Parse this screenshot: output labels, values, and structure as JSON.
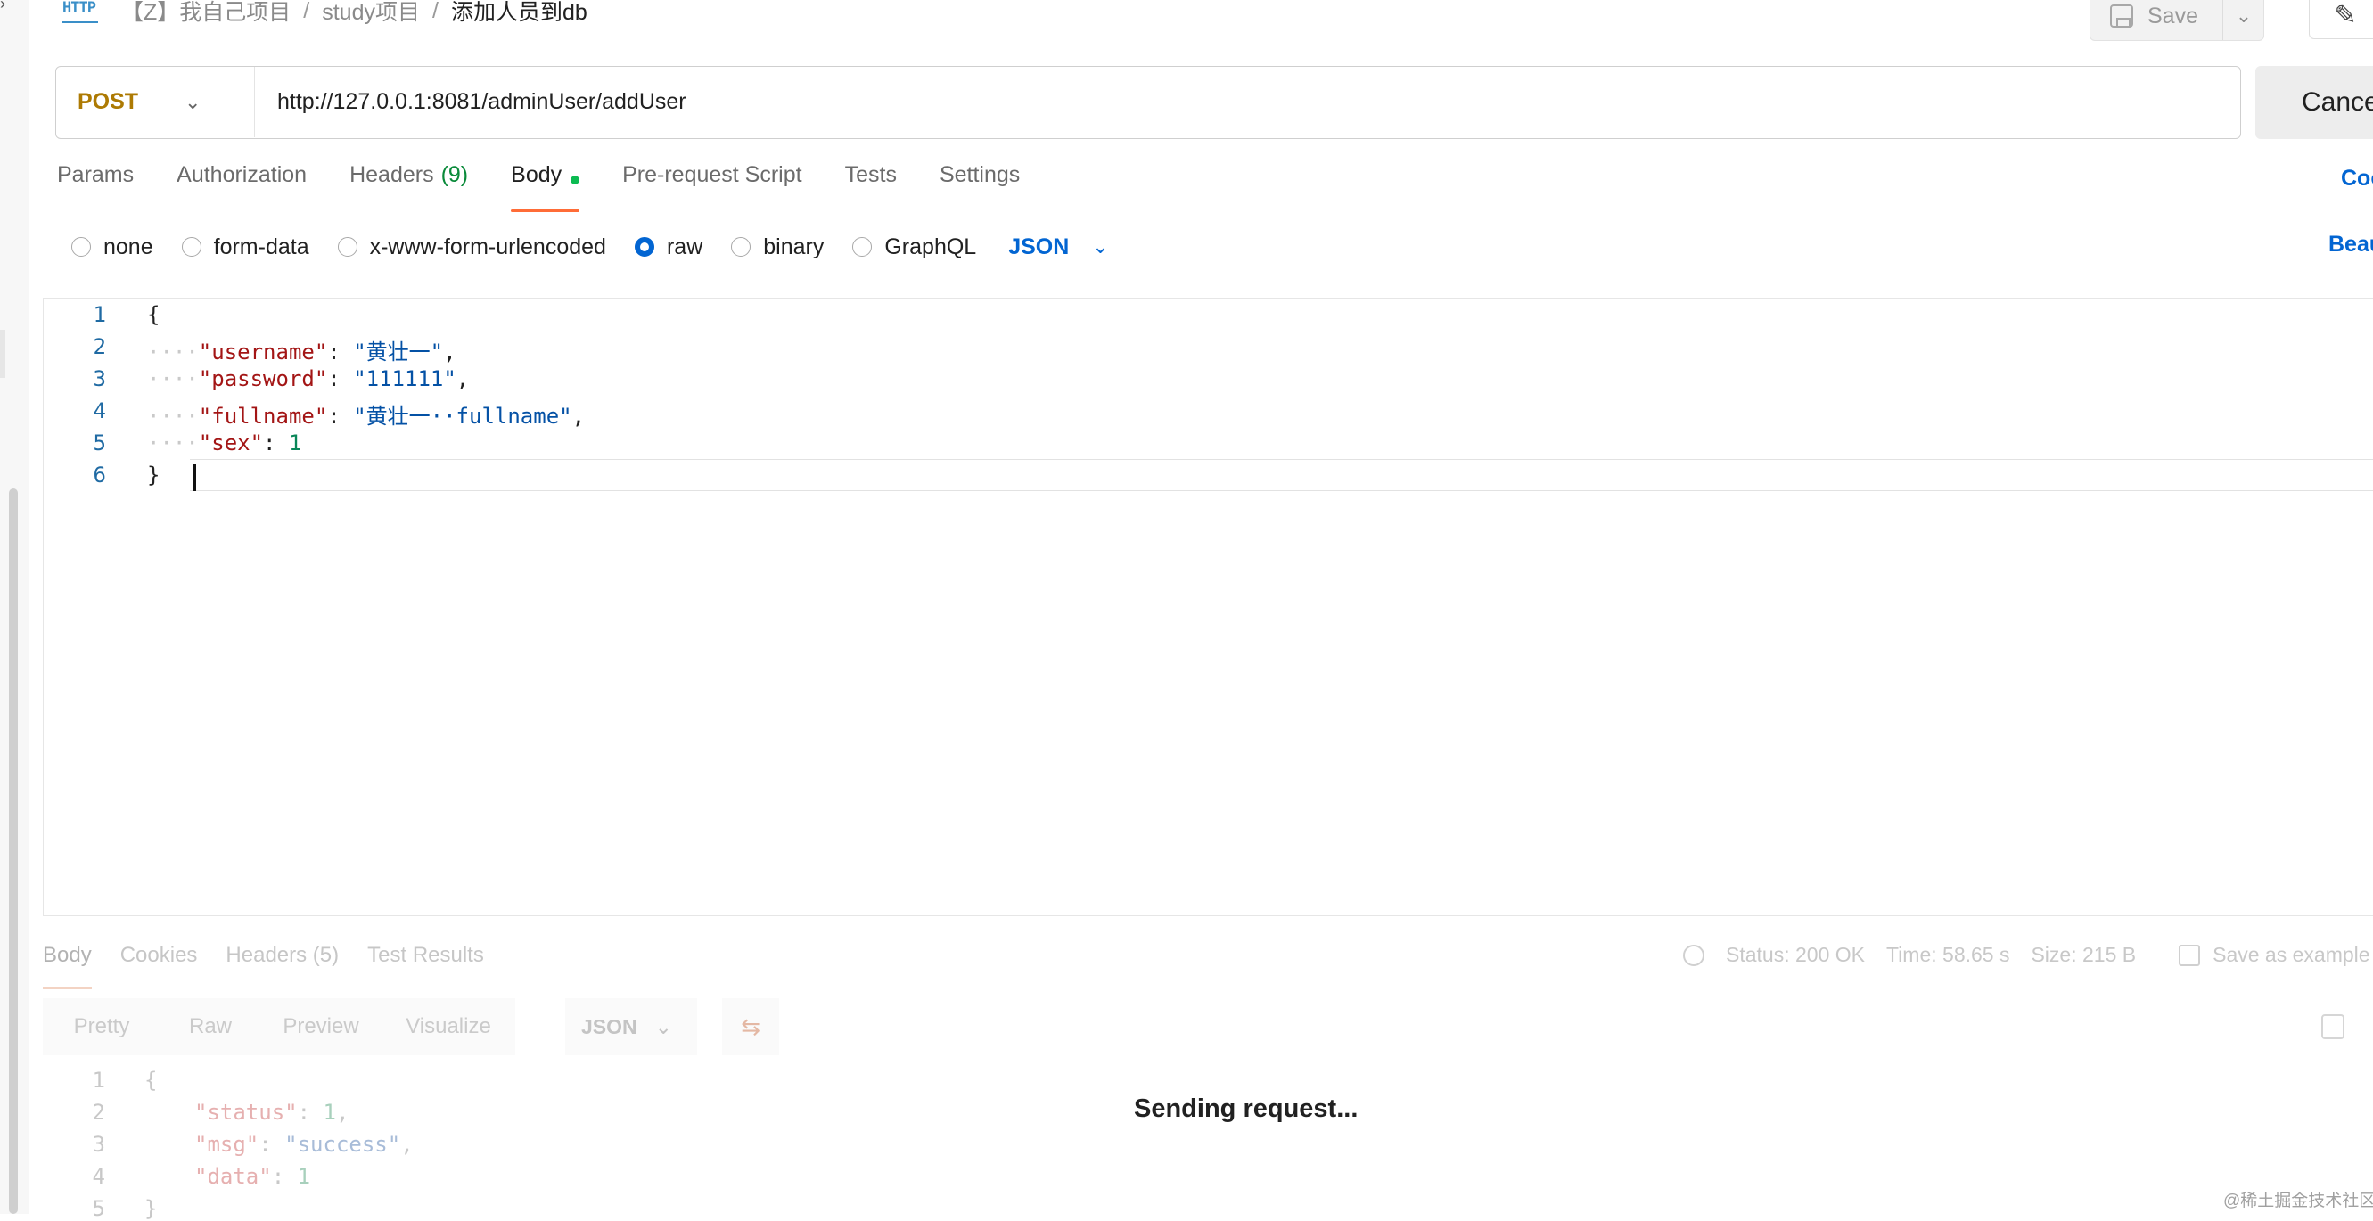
{
  "header": {
    "method_badge": "HTTP",
    "breadcrumb": [
      "【Z】我自己项目",
      "study项目",
      "添加人员到db"
    ],
    "separator": "/",
    "save_label": "Save",
    "save_dropdown_glyph": "⌄",
    "edit_glyph": "✎"
  },
  "request": {
    "method": "POST",
    "method_chevron": "⌄",
    "url": "http://127.0.0.1:8081/adminUser/addUser",
    "cancel_label": "Cancel"
  },
  "tabs": [
    {
      "label": "Params"
    },
    {
      "label": "Authorization"
    },
    {
      "label": "Headers",
      "count": "(9)"
    },
    {
      "label": "Body",
      "active": true
    },
    {
      "label": "Pre-request Script"
    },
    {
      "label": "Tests"
    },
    {
      "label": "Settings"
    }
  ],
  "cookies_link": "Cookies",
  "body_types": {
    "options": [
      "none",
      "form-data",
      "x-www-form-urlencoded",
      "raw",
      "binary",
      "GraphQL"
    ],
    "selected": "raw",
    "language": "JSON",
    "language_chevron": "⌄",
    "beautify_label": "Beautify"
  },
  "request_body": {
    "line_numbers": [
      "1",
      "2",
      "3",
      "4",
      "5",
      "6"
    ],
    "open_brace": "{",
    "close_brace": "}",
    "indent": "····",
    "colon": ":",
    "comma": ",",
    "pairs": [
      {
        "key": "\"username\"",
        "value": "\"黄壮一\"",
        "type": "string"
      },
      {
        "key": "\"password\"",
        "value": "\"111111\"",
        "type": "string"
      },
      {
        "key": "\"fullname\"",
        "value": "\"黄壮一··fullname\"",
        "type": "string"
      },
      {
        "key": "\"sex\"",
        "value": "1",
        "type": "number"
      }
    ]
  },
  "response": {
    "tabs": [
      "Body",
      "Cookies",
      "Headers (5)",
      "Test Results"
    ],
    "status": "Status: 200 OK",
    "time": "Time: 58.65 s",
    "size": "Size: 215 B",
    "save_example": "Save as example",
    "views": [
      "Pretty",
      "Raw",
      "Preview",
      "Visualize"
    ],
    "format": "JSON",
    "format_chevron": "⌄",
    "wrap_glyph": "⇆",
    "line_numbers": [
      "1",
      "2",
      "3",
      "4",
      "5"
    ],
    "open_brace": "{",
    "close_brace": "}",
    "pairs": [
      {
        "key": "\"status\"",
        "value": "1",
        "comma": ","
      },
      {
        "key": "\"msg\"",
        "value": "\"success\"",
        "comma": ","
      },
      {
        "key": "\"data\"",
        "value": "1",
        "comma": ""
      }
    ],
    "sending_text": "Sending request..."
  },
  "watermark": "@稀土掘金技术社区",
  "accent_colors": {
    "method": "#ad7a03",
    "link": "#0265d2",
    "active_tab": "#ff6c37",
    "dot": "#0cbb52"
  }
}
